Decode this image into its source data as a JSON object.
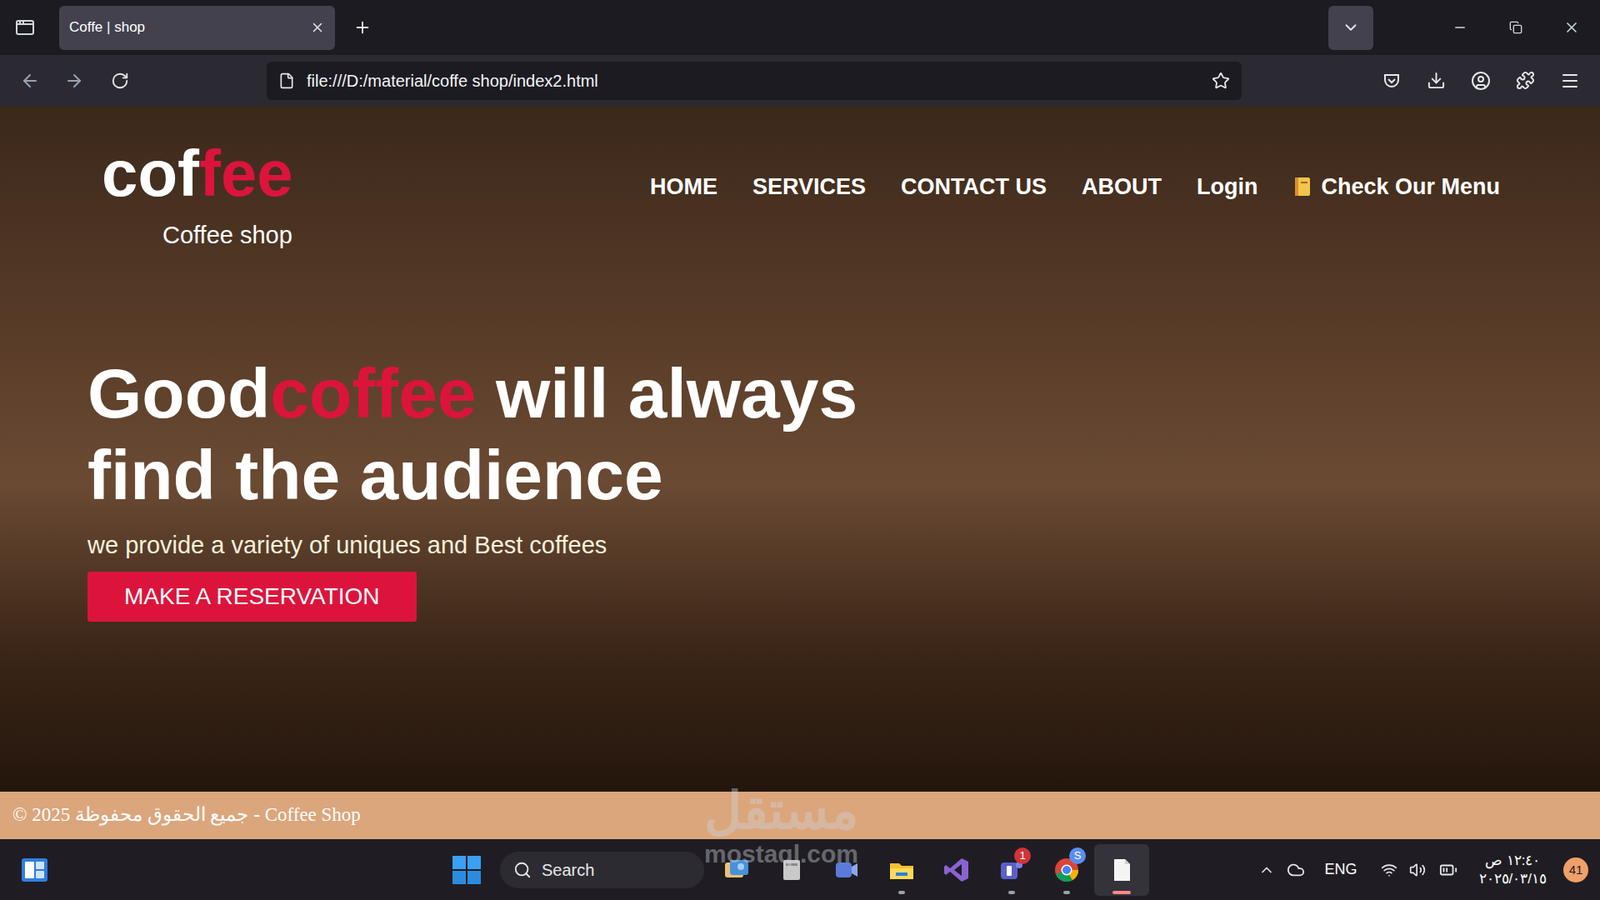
{
  "browser": {
    "tab": {
      "title": "Coffe | shop",
      "selected": true
    },
    "url": "file:///D:/material/coffe shop/index2.html"
  },
  "site": {
    "logo": {
      "first": "cof",
      "accent": "fee"
    },
    "tagline": "Coffee shop",
    "nav": [
      {
        "label": "HOME"
      },
      {
        "label": "SERVICES"
      },
      {
        "label": "CONTACT US"
      },
      {
        "label": "ABOUT"
      },
      {
        "label": "Login"
      }
    ],
    "menu_link": "Check Our Menu",
    "hero": {
      "heading": [
        {
          "text": "Good",
          "accent": false
        },
        {
          "text": "coffee",
          "accent": true
        },
        {
          "text": " will always find the audience",
          "accent": false
        }
      ],
      "subtitle": "we provide a variety of uniques and Best coffees",
      "button": "MAKE A RESERVATION"
    },
    "footer": "© 2025 جميع الحقوق محفوظة - Coffee Shop"
  },
  "taskbar": {
    "search": "Search",
    "apps": [
      {
        "badge": "",
        "running": false,
        "active": false
      },
      {
        "badge": "",
        "running": false,
        "active": false
      },
      {
        "badge": "",
        "running": false,
        "active": false
      },
      {
        "badge": "",
        "running": true,
        "active": false
      },
      {
        "badge": "",
        "running": false,
        "active": false
      },
      {
        "badge": "1",
        "running": true,
        "active": false
      },
      {
        "badge": "S",
        "running": true,
        "active": false
      },
      {
        "badge": "",
        "running": true,
        "active": true
      }
    ],
    "language": "ENG",
    "time": "١٢:٤٠ ص",
    "date": "٢٠٢٥/٠٣/١٥",
    "notifications": "41"
  },
  "watermark": {
    "logo": "مستقل",
    "site": "mostaql.com"
  }
}
